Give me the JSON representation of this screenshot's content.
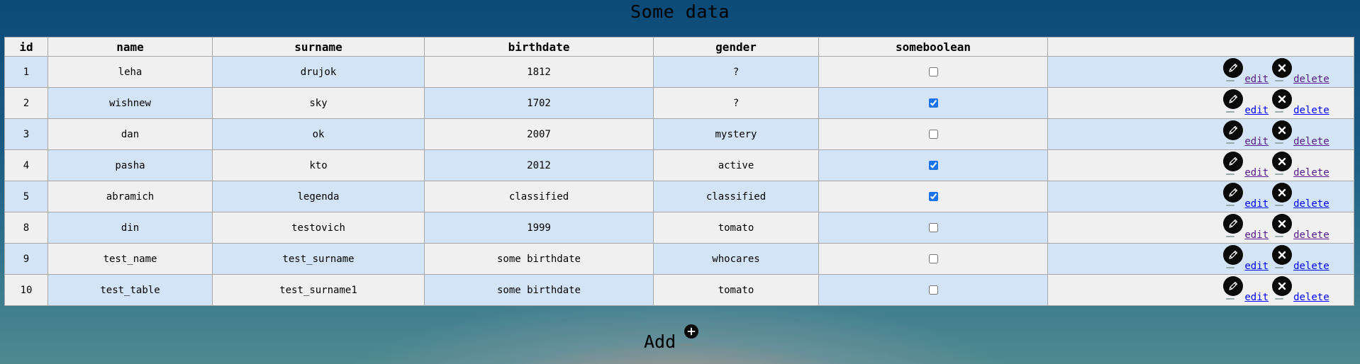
{
  "title": "Some data",
  "columns": [
    "id",
    "name",
    "surname",
    "birthdate",
    "gender",
    "someboolean",
    ""
  ],
  "rows": [
    {
      "id": "1",
      "name": "leha",
      "surname": "drujok",
      "birthdate": "1812",
      "gender": "?",
      "someboolean": false
    },
    {
      "id": "2",
      "name": "wishnew",
      "surname": "sky",
      "birthdate": "1702",
      "gender": "?",
      "someboolean": true
    },
    {
      "id": "3",
      "name": "dan",
      "surname": "ok",
      "birthdate": "2007",
      "gender": "mystery",
      "someboolean": false
    },
    {
      "id": "4",
      "name": "pasha",
      "surname": "kto",
      "birthdate": "2012",
      "gender": "active",
      "someboolean": true
    },
    {
      "id": "5",
      "name": "abramich",
      "surname": "legenda",
      "birthdate": "classified",
      "gender": "classified",
      "someboolean": true
    },
    {
      "id": "8",
      "name": "din",
      "surname": "testovich",
      "birthdate": "1999",
      "gender": "tomato",
      "someboolean": false
    },
    {
      "id": "9",
      "name": "test_name",
      "surname": "test_surname",
      "birthdate": "some birthdate",
      "gender": "whocares",
      "someboolean": false
    },
    {
      "id": "10",
      "name": "test_table",
      "surname": "test_surname1",
      "birthdate": "some birthdate",
      "gender": "tomato",
      "someboolean": false
    }
  ],
  "actions": {
    "edit_label": "edit",
    "delete_label": "delete",
    "edit_icon": "pencil-icon",
    "delete_icon": "close-icon"
  },
  "add": {
    "label": "Add",
    "icon": "plus-icon"
  },
  "colors": {
    "link": "#0000ee",
    "link_visited": "#551a8b",
    "row_blue": "#d2e4f5",
    "row_gray": "#f0f0f0",
    "icon_bg": "#0a0a0a"
  }
}
